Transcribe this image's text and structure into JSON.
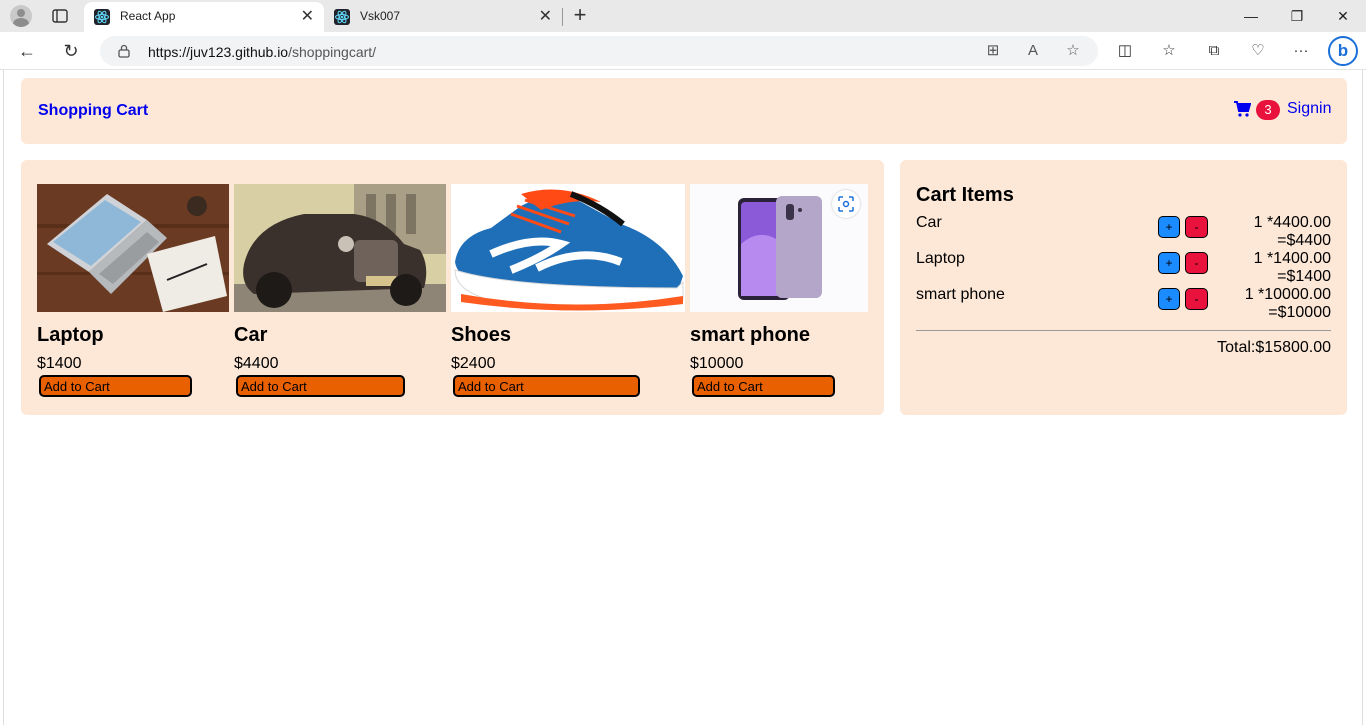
{
  "browser": {
    "tabs": [
      {
        "title": "React App",
        "active": true
      },
      {
        "title": "Vsk007",
        "active": false
      }
    ],
    "url_host": "https://juv123.github.io",
    "url_path": "/shoppingcart/",
    "window_controls": [
      "minimize-icon",
      "restore-icon",
      "close-icon"
    ]
  },
  "navbar": {
    "brand": "Shopping Cart",
    "cart_count": "3",
    "signin": "Signin"
  },
  "products": [
    {
      "name": "Laptop",
      "price": "$1400",
      "button": "Add to Cart",
      "image": "laptop-photo"
    },
    {
      "name": "Car",
      "price": "$4400",
      "button": "Add to Cart",
      "image": "vintage-car-photo"
    },
    {
      "name": "Shoes",
      "price": "$2400",
      "button": "Add to Cart",
      "image": "running-shoe-photo"
    },
    {
      "name": "smart phone",
      "price": "$10000",
      "button": "Add to Cart",
      "image": "smartphone-photo"
    }
  ],
  "cart": {
    "title": "Cart Items",
    "items": [
      {
        "name": "Car",
        "line1": "1 *4400.00",
        "line2": "=$4400",
        "plus": "+",
        "minus": "-"
      },
      {
        "name": "Laptop",
        "line1": "1 *1400.00",
        "line2": "=$1400",
        "plus": "+",
        "minus": "-"
      },
      {
        "name": "smart phone",
        "line1": "1 *10000.00",
        "line2": "=$10000",
        "plus": "+",
        "minus": "-"
      }
    ],
    "total": "Total:$15800.00"
  },
  "colors": {
    "panel_bg": "#fde8d8",
    "link_blue": "#0000ee",
    "add_button": "#e86000",
    "plus_button": "#1a8cff",
    "minus_button": "#e8123c"
  }
}
